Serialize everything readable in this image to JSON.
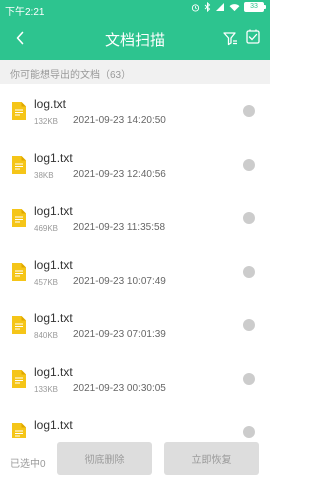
{
  "status": {
    "time": "下午2:21",
    "battery": "33"
  },
  "nav": {
    "title": "文档扫描"
  },
  "subheader": "你可能想导出的文档（63）",
  "files": [
    {
      "name": "log.txt",
      "size": "132KB",
      "time": "2021-09-23 14:20:50"
    },
    {
      "name": "log1.txt",
      "size": "38KB",
      "time": "2021-09-23 12:40:56"
    },
    {
      "name": "log1.txt",
      "size": "469KB",
      "time": "2021-09-23 11:35:58"
    },
    {
      "name": "log1.txt",
      "size": "457KB",
      "time": "2021-09-23 10:07:49"
    },
    {
      "name": "log1.txt",
      "size": "840KB",
      "time": "2021-09-23 07:01:39"
    },
    {
      "name": "log1.txt",
      "size": "133KB",
      "time": "2021-09-23 00:30:05"
    },
    {
      "name": "log1.txt",
      "size": "",
      "time": ""
    }
  ],
  "bottom": {
    "selected": "已选中0",
    "delete_label": "彻底删除",
    "restore_label": "立即恢复"
  },
  "colors": {
    "accent": "#2dc48f",
    "file_icon": "#f5c518",
    "radio": "#cccccc",
    "button_disabled": "#dddddd"
  }
}
